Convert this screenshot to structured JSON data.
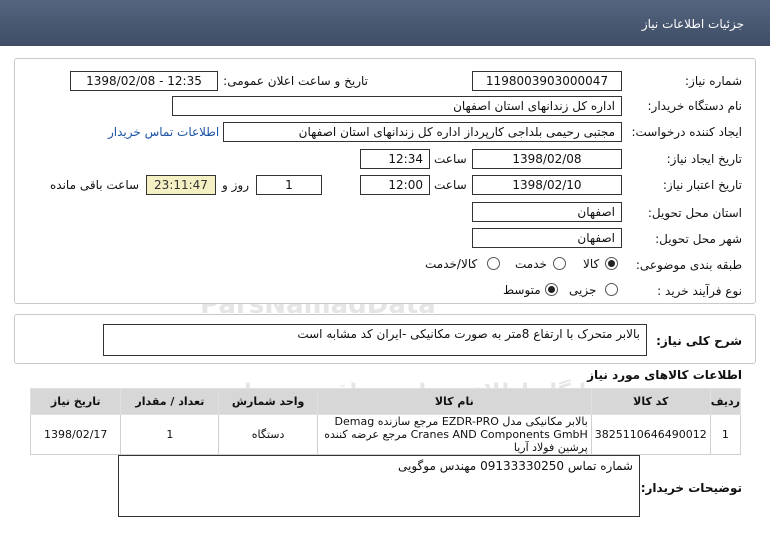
{
  "header": {
    "title": "جزئیات اطلاعات نیاز"
  },
  "info": {
    "need_number_label": "شماره نیاز:",
    "need_number": "1198003903000047",
    "announce_label": "تاریخ و ساعت اعلان عمومی:",
    "announce_value": "1398/02/08 - 12:35",
    "buyer_org_label": "نام دستگاه خریدار:",
    "buyer_org": "اداره کل زندانهای استان اصفهان",
    "requester_label": "ایجاد کننده درخواست:",
    "requester": "مجتبی رحیمی بلداجی کارپرداز اداره کل زندانهای استان اصفهان",
    "contact_link": "اطلاعات تماس خریدار",
    "created_label": "تاریخ ایجاد نیاز:",
    "created_date": "1398/02/08",
    "time_label": "ساعت",
    "created_time": "12:34",
    "valid_label": "تاریخ اعتبار نیاز:",
    "valid_date": "1398/02/10",
    "valid_time": "12:00",
    "days": "1",
    "days_label": "روز و",
    "remaining": "23:11:47",
    "remaining_label": "ساعت باقی مانده",
    "province_label": "استان محل تحویل:",
    "province": "اصفهان",
    "city_label": "شهر محل تحویل:",
    "city": "اصفهان",
    "category_label": "طبقه بندی موضوعی:",
    "category_options": [
      "کالا",
      "خدمت",
      "کالا/خدمت"
    ],
    "category_selected": "کالا",
    "process_label": "نوع فرآیند خرید :",
    "process_options": [
      "جزیی",
      "متوسط"
    ],
    "process_selected": "متوسط"
  },
  "summary": {
    "label": "شرح کلی نیاز:",
    "text": "بالابر متحرک با ارتفاع 8متر به صورت مکانیکی -ایران کد مشابه است"
  },
  "goods": {
    "section_title": "اطلاعات کالاهای مورد نیاز",
    "columns": [
      "ردیف",
      "کد کالا",
      "نام کالا",
      "واحد شمارش",
      "تعداد / مقدار",
      "تاریخ نیاز"
    ],
    "rows": [
      {
        "row": "1",
        "code": "3825110646490012",
        "name": "بالابر مکانیکی مدل EZDR-PRO مرجع سازنده Demag Cranes AND Components GmbH مرجع عرضه کننده پرشین فولاد آریا",
        "unit": "دستگاه",
        "qty": "1",
        "date": "1398/02/17"
      }
    ]
  },
  "notes": {
    "label": "توضیحات خریدار:",
    "text": "شماره تماس 09133330250 مهندس موگویی"
  },
  "watermark": {
    "line1": "ParsNamadData",
    "line2": "پایگاه اطلاع رسانی مناقصه ومزایده"
  }
}
